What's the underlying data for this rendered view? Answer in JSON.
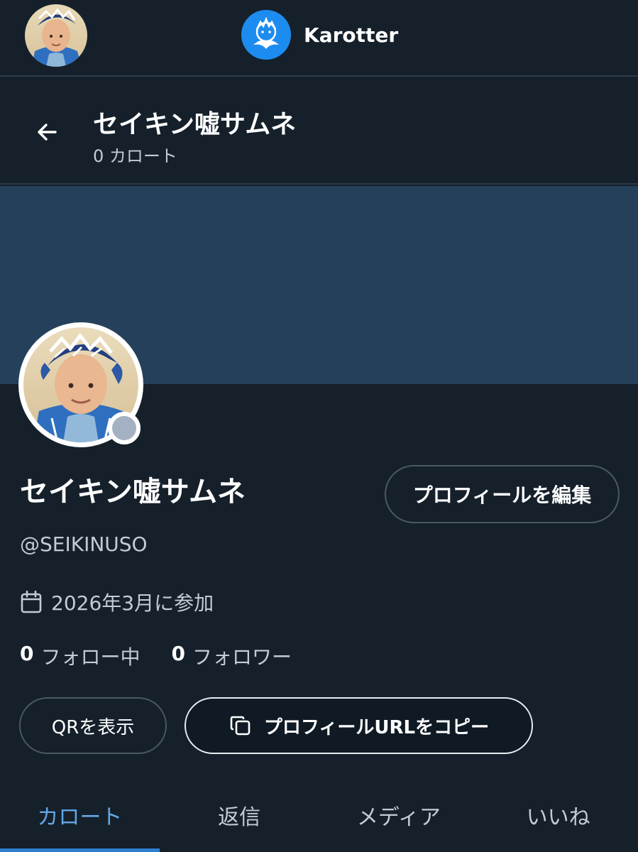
{
  "topbar": {
    "brand_name": "Karotter"
  },
  "header": {
    "title": "セイキン嘘サムネ",
    "subtitle": "0 カロート"
  },
  "profile": {
    "display_name": "セイキン嘘サムネ",
    "handle": "@SEIKINUSO",
    "joined": "2026年3月に参加",
    "edit_button": "プロフィールを編集",
    "following_count": "0",
    "following_label": "フォロー中",
    "followers_count": "0",
    "followers_label": "フォロワー",
    "qr_button": "QRを表示",
    "copy_url_button": "プロフィールURLをコピー"
  },
  "tabs": [
    {
      "label": "カロート",
      "active": true
    },
    {
      "label": "返信",
      "active": false
    },
    {
      "label": "メディア",
      "active": false
    },
    {
      "label": "いいね",
      "active": false
    }
  ],
  "colors": {
    "background": "#15202b",
    "banner": "#25405a",
    "accent": "#2f7fd1",
    "brand": "#1d8cf0",
    "muted_text": "#c2ccd6"
  },
  "icons": [
    "back-arrow-icon",
    "calendar-icon",
    "copy-icon",
    "brand-logo-icon"
  ]
}
